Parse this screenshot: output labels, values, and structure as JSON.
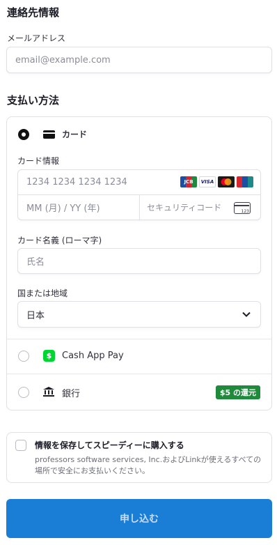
{
  "contact": {
    "title": "連絡先情報",
    "email_label": "メールアドレス",
    "email_placeholder": "email@example.com"
  },
  "payment": {
    "title": "支払い方法",
    "card_option_label": "カード",
    "card_info_label": "カード情報",
    "card_number_placeholder": "1234 1234 1234 1234",
    "expiry_placeholder": "MM (月) / YY (年)",
    "cvc_placeholder": "セキュリティコード",
    "cvc_hint": "123",
    "name_label": "カード名義 (ローマ字)",
    "name_placeholder": "氏名",
    "country_label": "国または地域",
    "country_value": "日本",
    "brands": [
      "JCB",
      "VISA",
      "Mastercard",
      "UnionPay"
    ],
    "cashapp_label": "Cash App Pay",
    "bank_label": "銀行",
    "bank_badge": "$5 の還元"
  },
  "save_info": {
    "title": "情報を保存してスピーディーに購入する",
    "description": "professors software services, Inc.およびLinkが使えるすべての場所で安全にお支払いください。"
  },
  "submit_label": "申し込む",
  "colors": {
    "primary": "#1a7dd6",
    "badge": "#1f8a3b",
    "cashapp": "#00d632"
  }
}
